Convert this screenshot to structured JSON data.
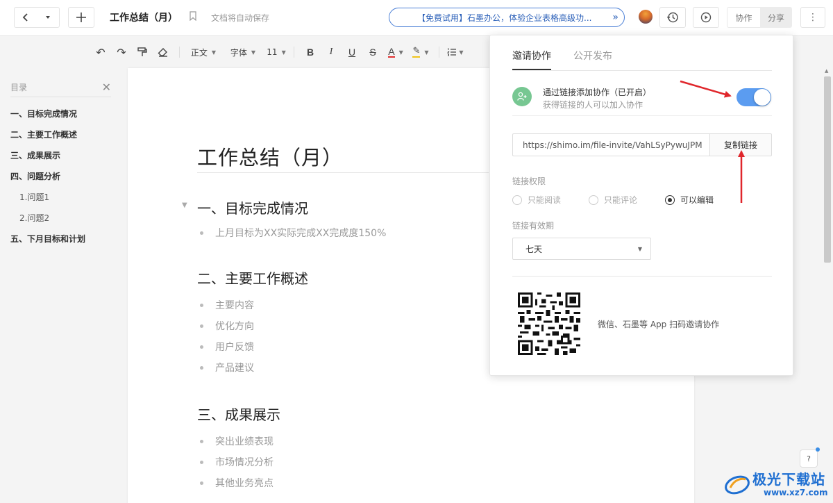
{
  "header": {
    "doc_title": "工作总结（月）",
    "autosave_text": "文档将自动保存",
    "promo_text": "【免费试用】石墨办公，体验企业表格高级功...",
    "collab_tab": "协作",
    "share_tab": "分享"
  },
  "toolbar": {
    "style_label": "正文",
    "font_label": "字体",
    "size_label": "11"
  },
  "outline": {
    "title": "目录",
    "items": [
      {
        "label": "一、目标完成情况",
        "level": 1
      },
      {
        "label": "二、主要工作概述",
        "level": 1
      },
      {
        "label": "三、成果展示",
        "level": 1
      },
      {
        "label": "四、问题分析",
        "level": 1
      },
      {
        "label": "1.问题1",
        "level": 2
      },
      {
        "label": "2.问题2",
        "level": 2
      },
      {
        "label": "五、下月目标和计划",
        "level": 1
      }
    ]
  },
  "document": {
    "title": "工作总结（月）",
    "sections": [
      {
        "heading": "一、目标完成情况",
        "bullets": [
          "上月目标为XX实际完成XX完成度150%"
        ]
      },
      {
        "heading": "二、主要工作概述",
        "bullets": [
          "主要内容",
          "优化方向",
          "用户反馈",
          "产品建议"
        ]
      },
      {
        "heading": "三、成果展示",
        "bullets": [
          "突出业绩表现",
          "市场情况分析",
          "其他业务亮点"
        ]
      }
    ]
  },
  "share_popover": {
    "tabs": [
      "邀请协作",
      "公开发布"
    ],
    "active_tab": "邀请协作",
    "link_title": "通过链接添加协作（已开启）",
    "link_subtitle": "获得链接的人可以加入协作",
    "link_enabled": true,
    "invite_url": "https://shimo.im/file-invite/VahLSyPywuJPM",
    "copy_button": "复制链接",
    "permission_label": "链接权限",
    "permission_options": [
      "只能阅读",
      "只能评论",
      "可以编辑"
    ],
    "permission_selected": "可以编辑",
    "validity_label": "链接有效期",
    "validity_value": "七天",
    "qr_caption": "微信、石墨等 App 扫码邀请协作"
  },
  "watermark": {
    "text": "极光下载站",
    "url": "www.xz7.com"
  },
  "colors": {
    "accent": "#5b9cf0",
    "promo_border": "#4a7fd6",
    "annotation_arrow": "#e0262b"
  }
}
